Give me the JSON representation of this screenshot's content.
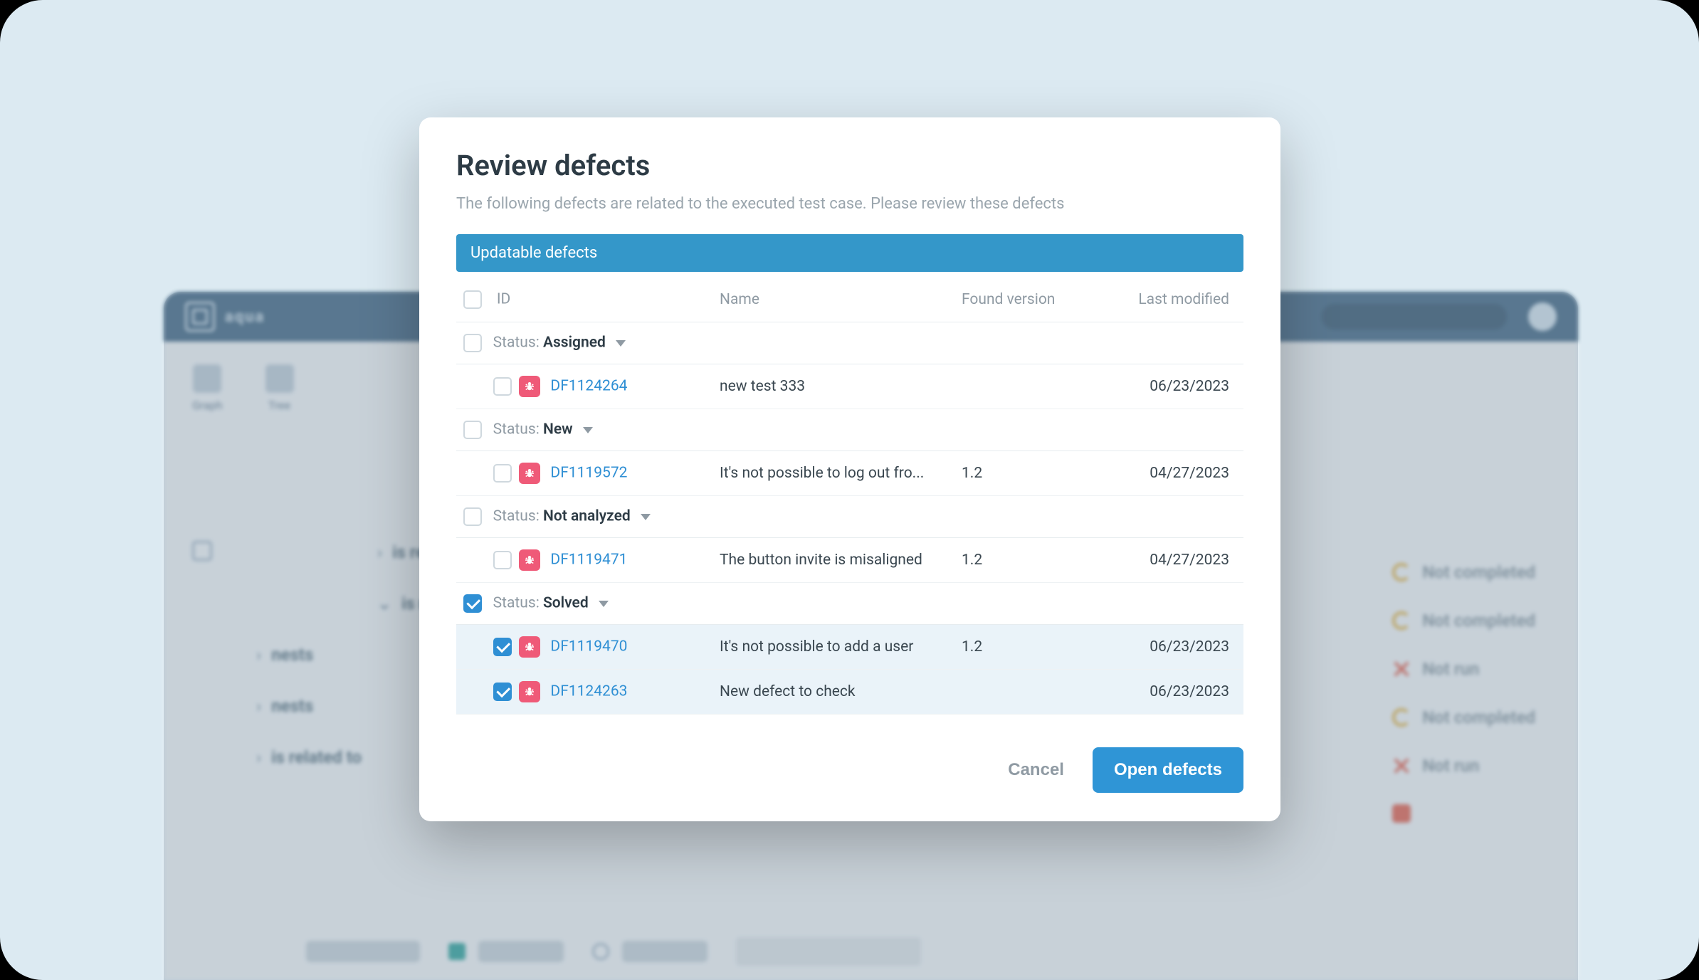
{
  "modal": {
    "title": "Review defects",
    "subtitle": "The following defects are related to the executed test case. Please review these defects",
    "band": "Updatable defects",
    "columns": {
      "id": "ID",
      "name": "Name",
      "version": "Found version",
      "modified": "Last modified"
    },
    "status_label": "Status:",
    "groups": [
      {
        "status": "Assigned",
        "checked": false,
        "rows": [
          {
            "checked": false,
            "id": "DF1124264",
            "name": "new test 333",
            "version": "",
            "modified": "06/23/2023"
          }
        ]
      },
      {
        "status": "New",
        "checked": false,
        "rows": [
          {
            "checked": false,
            "id": "DF1119572",
            "name": "It's not possible to log out fro...",
            "version": "1.2",
            "modified": "04/27/2023"
          }
        ]
      },
      {
        "status": "Not analyzed",
        "checked": false,
        "rows": [
          {
            "checked": false,
            "id": "DF1119471",
            "name": "The button invite is misaligned",
            "version": "1.2",
            "modified": "04/27/2023"
          }
        ]
      },
      {
        "status": "Solved",
        "checked": true,
        "rows": [
          {
            "checked": true,
            "id": "DF1119470",
            "name": "It's not possible to add a user",
            "version": "1.2",
            "modified": "06/23/2023"
          },
          {
            "checked": true,
            "id": "DF1124263",
            "name": "New defect to check",
            "version": "",
            "modified": "06/23/2023"
          }
        ]
      }
    ],
    "buttons": {
      "cancel": "Cancel",
      "primary": "Open defects"
    }
  },
  "background": {
    "brand": "aqua",
    "tools": [
      "Graph",
      "Tree"
    ],
    "tree": [
      "is related to",
      "is related to",
      "nests",
      "nests",
      "is related to"
    ],
    "statuses": [
      {
        "icon": "clock",
        "label": "Not completed"
      },
      {
        "icon": "clock",
        "label": "Not completed"
      },
      {
        "icon": "x",
        "label": "Not run"
      },
      {
        "icon": "clock",
        "label": "Not completed"
      },
      {
        "icon": "x",
        "label": "Not run"
      },
      {
        "icon": "sq",
        "label": ""
      }
    ]
  }
}
